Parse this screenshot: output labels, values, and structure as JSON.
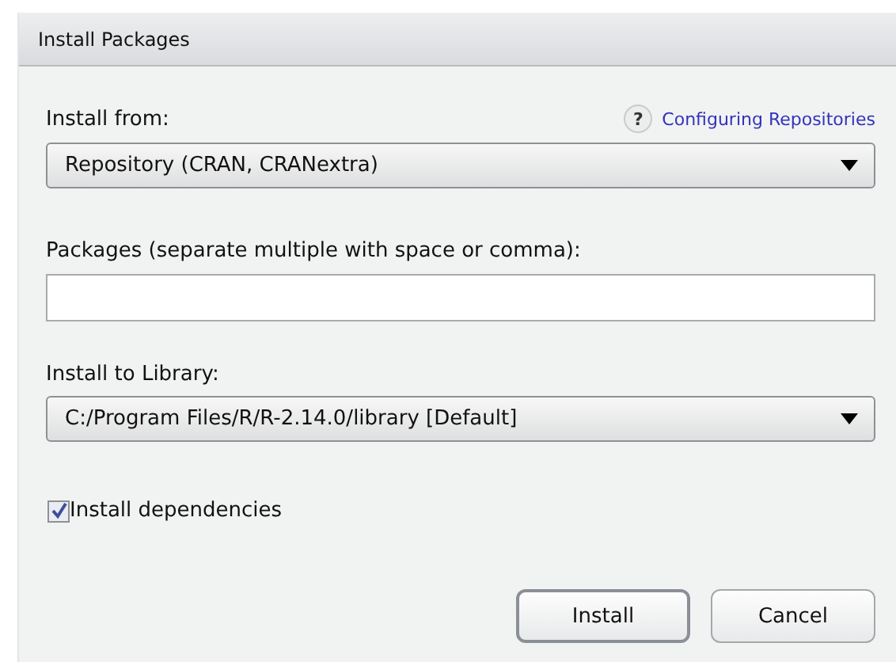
{
  "window": {
    "title": "Install Packages"
  },
  "install_from": {
    "label": "Install from:",
    "help_icon": "?",
    "help_link": "Configuring Repositories",
    "value": "Repository (CRAN, CRANextra)"
  },
  "packages": {
    "label": "Packages (separate multiple with space or comma):"
  },
  "library": {
    "label": "Install to Library:",
    "value": "C:/Program Files/R/R-2.14.0/library [Default]"
  },
  "dependencies": {
    "label": "Install dependencies",
    "checked": true
  },
  "buttons": [
    {
      "label": "Install",
      "kind": "default"
    },
    {
      "label": "Cancel",
      "kind": "normal"
    }
  ]
}
